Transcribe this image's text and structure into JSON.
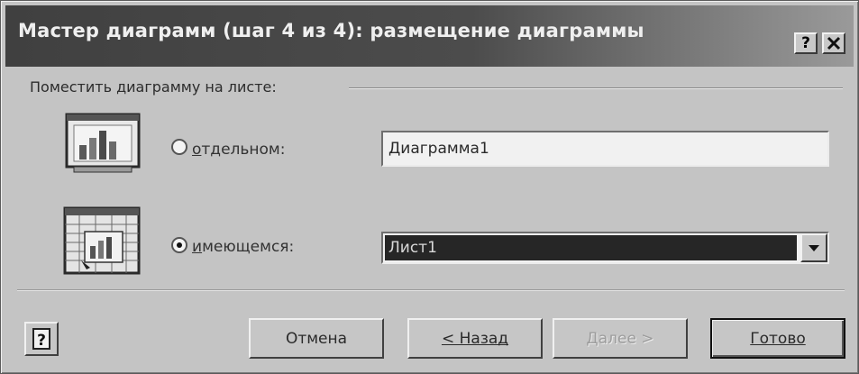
{
  "window": {
    "title": "Мастер диаграмм (шаг 4 из 4): размещение диаграммы",
    "help_button": "?",
    "close_button": "×"
  },
  "placement": {
    "group_label": "Поместить диаграмму на листе:",
    "separate": {
      "label": "отдельном:",
      "underline_char": "о",
      "rest": "тдельном:",
      "value": "Диаграмма1",
      "checked": false
    },
    "existing": {
      "label": "имеющемся:",
      "underline_char": "и",
      "rest": "меющемся:",
      "selected": "Лист1",
      "checked": true
    }
  },
  "buttons": {
    "help": "?",
    "cancel": "Отмена",
    "back": "< Назад",
    "next": "Далее >",
    "finish": "Готово"
  },
  "colors": {
    "dialog_bg": "#c4c4c4",
    "title_bar": "#404040",
    "selection": "#262626"
  }
}
